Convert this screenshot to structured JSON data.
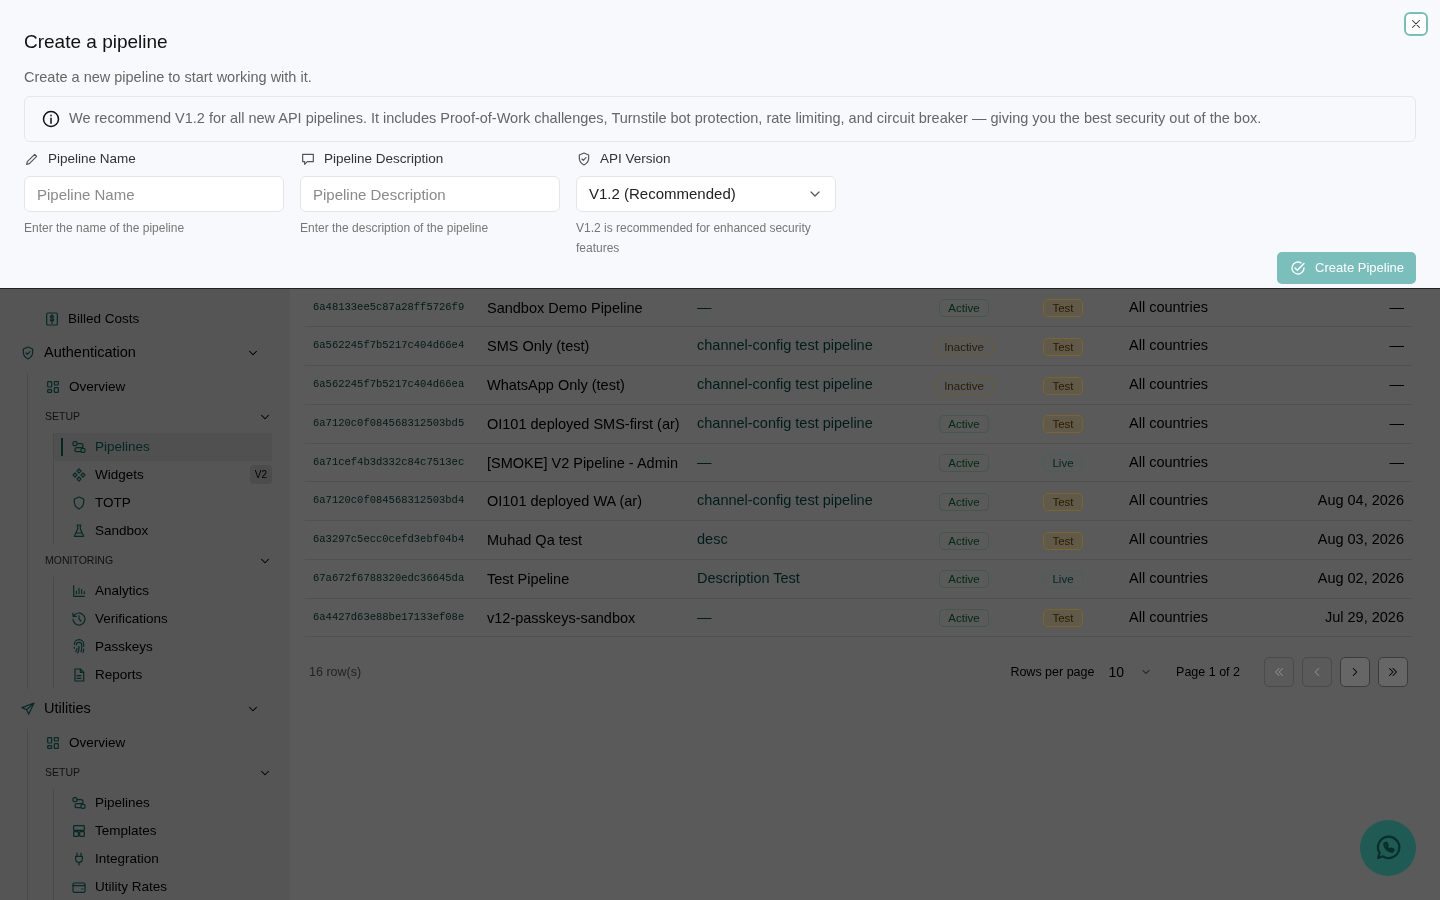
{
  "modal": {
    "title": "Create a pipeline",
    "subtitle": "Create a new pipeline to start working with it.",
    "notice": "We recommend V1.2 for all new API pipelines. It includes Proof-of-Work challenges, Turnstile bot protection, rate limiting, and circuit breaker — giving you the best security out of the box.",
    "fields": [
      {
        "kind": "text",
        "label": "Pipeline Name",
        "placeholder": "Pipeline Name",
        "help": "Enter the name of the pipeline"
      },
      {
        "kind": "text",
        "label": "Pipeline Description",
        "placeholder": "Pipeline Description",
        "help": "Enter the description of the pipeline"
      },
      {
        "kind": "select",
        "label": "API Version",
        "value": "V1.2 (Recommended)",
        "help": "V1.2 is recommended for enhanced security features"
      }
    ],
    "submit": "Create Pipeline"
  },
  "sidebar": {
    "items": [
      {
        "label": "Billed Costs",
        "selected": false
      }
    ],
    "sections": [
      {
        "title": "Authentication",
        "expanded": true,
        "items": [
          {
            "label": "Overview",
            "selected": false
          }
        ],
        "groups": [
          {
            "title": "SETUP",
            "expanded": true,
            "items": [
              {
                "label": "Pipelines",
                "selected": true
              },
              {
                "label": "Widgets",
                "selected": false,
                "badge": "V2"
              },
              {
                "label": "TOTP",
                "selected": false
              },
              {
                "label": "Sandbox",
                "selected": false
              }
            ]
          },
          {
            "title": "MONITORING",
            "expanded": true,
            "items": [
              {
                "label": "Analytics",
                "selected": false
              },
              {
                "label": "Verifications",
                "selected": false
              },
              {
                "label": "Passkeys",
                "selected": false
              },
              {
                "label": "Reports",
                "selected": false
              }
            ]
          }
        ]
      },
      {
        "title": "Utilities",
        "expanded": true,
        "items": [
          {
            "label": "Overview",
            "selected": false
          }
        ],
        "groups": [
          {
            "title": "SETUP",
            "expanded": true,
            "items": [
              {
                "label": "Pipelines",
                "selected": false
              },
              {
                "label": "Templates",
                "selected": false
              },
              {
                "label": "Integration",
                "selected": false
              },
              {
                "label": "Utility Rates",
                "selected": false
              }
            ]
          }
        ]
      }
    ]
  },
  "table": {
    "rows": [
      {
        "id": "6a48133ee5c87a28ff5726f9",
        "name": "Sandbox Demo Pipeline",
        "description": "—",
        "status": {
          "label": "Active",
          "kind": "active"
        },
        "environment": {
          "label": "Test",
          "kind": "test"
        },
        "countries": "All countries",
        "date": "—"
      },
      {
        "id": "6a562245f7b5217c404d66e4",
        "name": "SMS Only (test)",
        "description": "channel-config test pipeline",
        "status": {
          "label": "Inactive",
          "kind": "inactive"
        },
        "environment": {
          "label": "Test",
          "kind": "test"
        },
        "countries": "All countries",
        "date": "—"
      },
      {
        "id": "6a562245f7b5217c404d66ea",
        "name": "WhatsApp Only (test)",
        "description": "channel-config test pipeline",
        "status": {
          "label": "Inactive",
          "kind": "inactive"
        },
        "environment": {
          "label": "Test",
          "kind": "test"
        },
        "countries": "All countries",
        "date": "—"
      },
      {
        "id": "6a7120c0f084568312503bd5",
        "name": "OI101 deployed SMS-first (ar)",
        "description": "channel-config test pipeline",
        "status": {
          "label": "Active",
          "kind": "active"
        },
        "environment": {
          "label": "Test",
          "kind": "test"
        },
        "countries": "All countries",
        "date": "—"
      },
      {
        "id": "6a71cef4b3d332c84c7513ec",
        "name": "[SMOKE] V2 Pipeline - Admin",
        "description": "—",
        "status": {
          "label": "Active",
          "kind": "active"
        },
        "environment": {
          "label": "Live",
          "kind": "live"
        },
        "countries": "All countries",
        "date": "—"
      },
      {
        "id": "6a7120c0f084568312503bd4",
        "name": "OI101 deployed WA (ar)",
        "description": "channel-config test pipeline",
        "status": {
          "label": "Active",
          "kind": "active"
        },
        "environment": {
          "label": "Test",
          "kind": "test"
        },
        "countries": "All countries",
        "date": "Aug 04, 2026"
      },
      {
        "id": "6a3297c5ecc0cefd3ebf04b4",
        "name": "Muhad Qa test",
        "description": "desc",
        "status": {
          "label": "Active",
          "kind": "active"
        },
        "environment": {
          "label": "Test",
          "kind": "test"
        },
        "countries": "All countries",
        "date": "Aug 03, 2026"
      },
      {
        "id": "67a672f6788320edc36645da",
        "name": "Test Pipeline",
        "description": "Description Test",
        "status": {
          "label": "Active",
          "kind": "active"
        },
        "environment": {
          "label": "Live",
          "kind": "live"
        },
        "countries": "All countries",
        "date": "Aug 02, 2026"
      },
      {
        "id": "6a4427d63e88be17133ef08e",
        "name": "v12-passkeys-sandbox",
        "description": "—",
        "status": {
          "label": "Active",
          "kind": "active"
        },
        "environment": {
          "label": "Test",
          "kind": "test"
        },
        "countries": "All countries",
        "date": "Jul 29, 2026"
      }
    ]
  },
  "pagination": {
    "row_count": "16 row(s)",
    "rows_per_page_label": "Rows per page",
    "rows_per_page": "10",
    "page": "Page 1 of 2",
    "buttons": [
      {
        "kind": "first",
        "disabled": true
      },
      {
        "kind": "prev",
        "disabled": true
      },
      {
        "kind": "next",
        "disabled": false
      },
      {
        "kind": "last",
        "disabled": false
      }
    ]
  }
}
